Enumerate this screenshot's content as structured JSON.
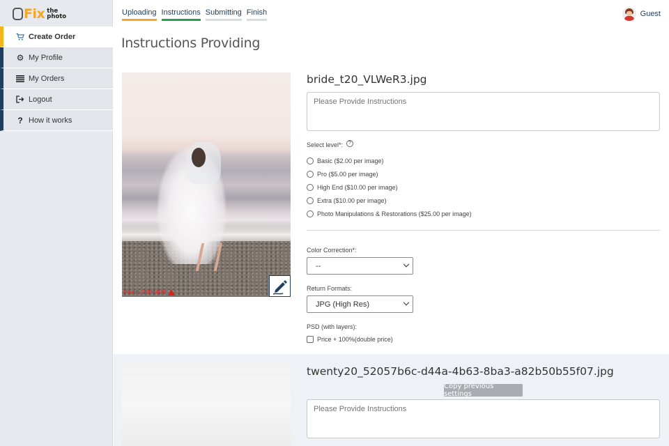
{
  "brand": {
    "logo_fix": "Fix",
    "logo_the": "the",
    "logo_photo": "photo"
  },
  "sidebar": {
    "items": [
      {
        "label": "Create Order",
        "icon": "cart-icon",
        "active": true
      },
      {
        "label": "My Profile",
        "icon": "gear-icon"
      },
      {
        "label": "My Orders",
        "icon": "list-icon"
      },
      {
        "label": "Logout",
        "icon": "logout-icon"
      },
      {
        "label": "How it works",
        "icon": "question-icon"
      }
    ]
  },
  "steps": [
    "Uploading",
    "Instructions",
    "Submitting",
    "Finish"
  ],
  "user": {
    "name": "Guest"
  },
  "page": {
    "title": "Instructions Providing"
  },
  "image1": {
    "filename": "bride_t20_VLWeR3.jpg",
    "warning_text": "Pixels 300x408",
    "instructions_placeholder": "Please Provide Instructions",
    "level_label": "Select level*:",
    "levels": [
      "Basic ($2.00 per image)",
      "Pro ($5.00 per image)",
      "High End ($10.00 per image)",
      "Extra ($10.00 per image)",
      "Photo Manipulations & Restorations ($25.00 per image)"
    ],
    "color_correction_label": "Color Correction*:",
    "color_correction_value": "--",
    "return_formats_label": "Return Formats:",
    "return_formats_value": "JPG (High Res)",
    "psd_label": "PSD (with layers):",
    "psd_option": "Price + 100%(double price)"
  },
  "image2": {
    "filename": "twenty20_52057b6c-d44a-4b63-8ba3-a82b50b55f07.jpg",
    "copy_button": "Copy previous settings",
    "instructions_placeholder": "Please Provide Instructions"
  },
  "colors": {
    "accent_orange": "#f5a623",
    "accent_green": "#22a24a",
    "navy": "#1f3d5e"
  }
}
